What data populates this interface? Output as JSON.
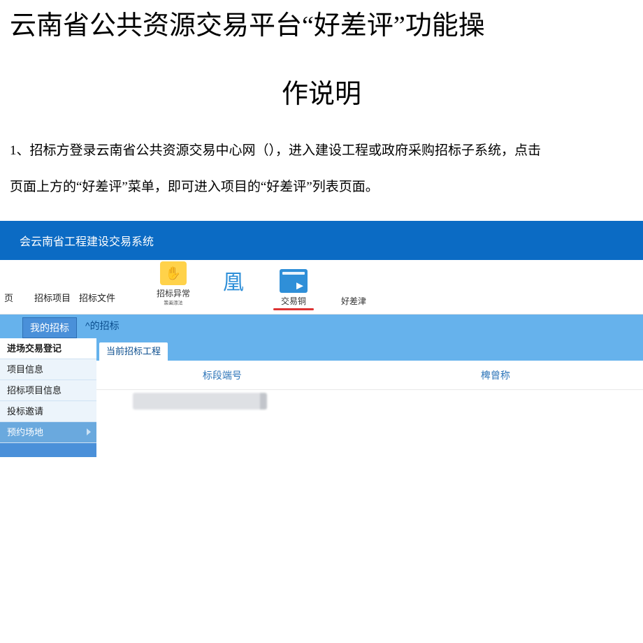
{
  "title_line1": "云南省公共资源交易平台“好差评”功能操",
  "title_line2": "作说明",
  "para1": "1、招标方登录云南省公共资源交易中心网（），进入建设工程或政府采购招标子系统，点击",
  "para2": "页面上方的“好差评”菜单，即可进入项目的“好差评”列表页面。",
  "app": {
    "system_title": "会云南省工程建设交易系统",
    "nav_xiangmu": "页",
    "nav_zhaobiao_xm": "招标项目",
    "nav_zhaobiao_wj": "招标文件",
    "nav_yc": "招标异常",
    "nav_yc_sub": "策画漂法",
    "nav_huang": "凰",
    "nav_jiaoyi": "交易铜",
    "nav_haocha": "好差津",
    "tab_mybid": "我的招标",
    "tab_hisbid": "^的招标",
    "side": {
      "m0": "进场交易登记",
      "m1": "项目信息",
      "m2": "招标项目信息",
      "m3": "投标邀请",
      "m4": "预约场地"
    },
    "subtab_current": "当前招标工程",
    "col1": "标段端号",
    "col2": "椑曾称"
  }
}
